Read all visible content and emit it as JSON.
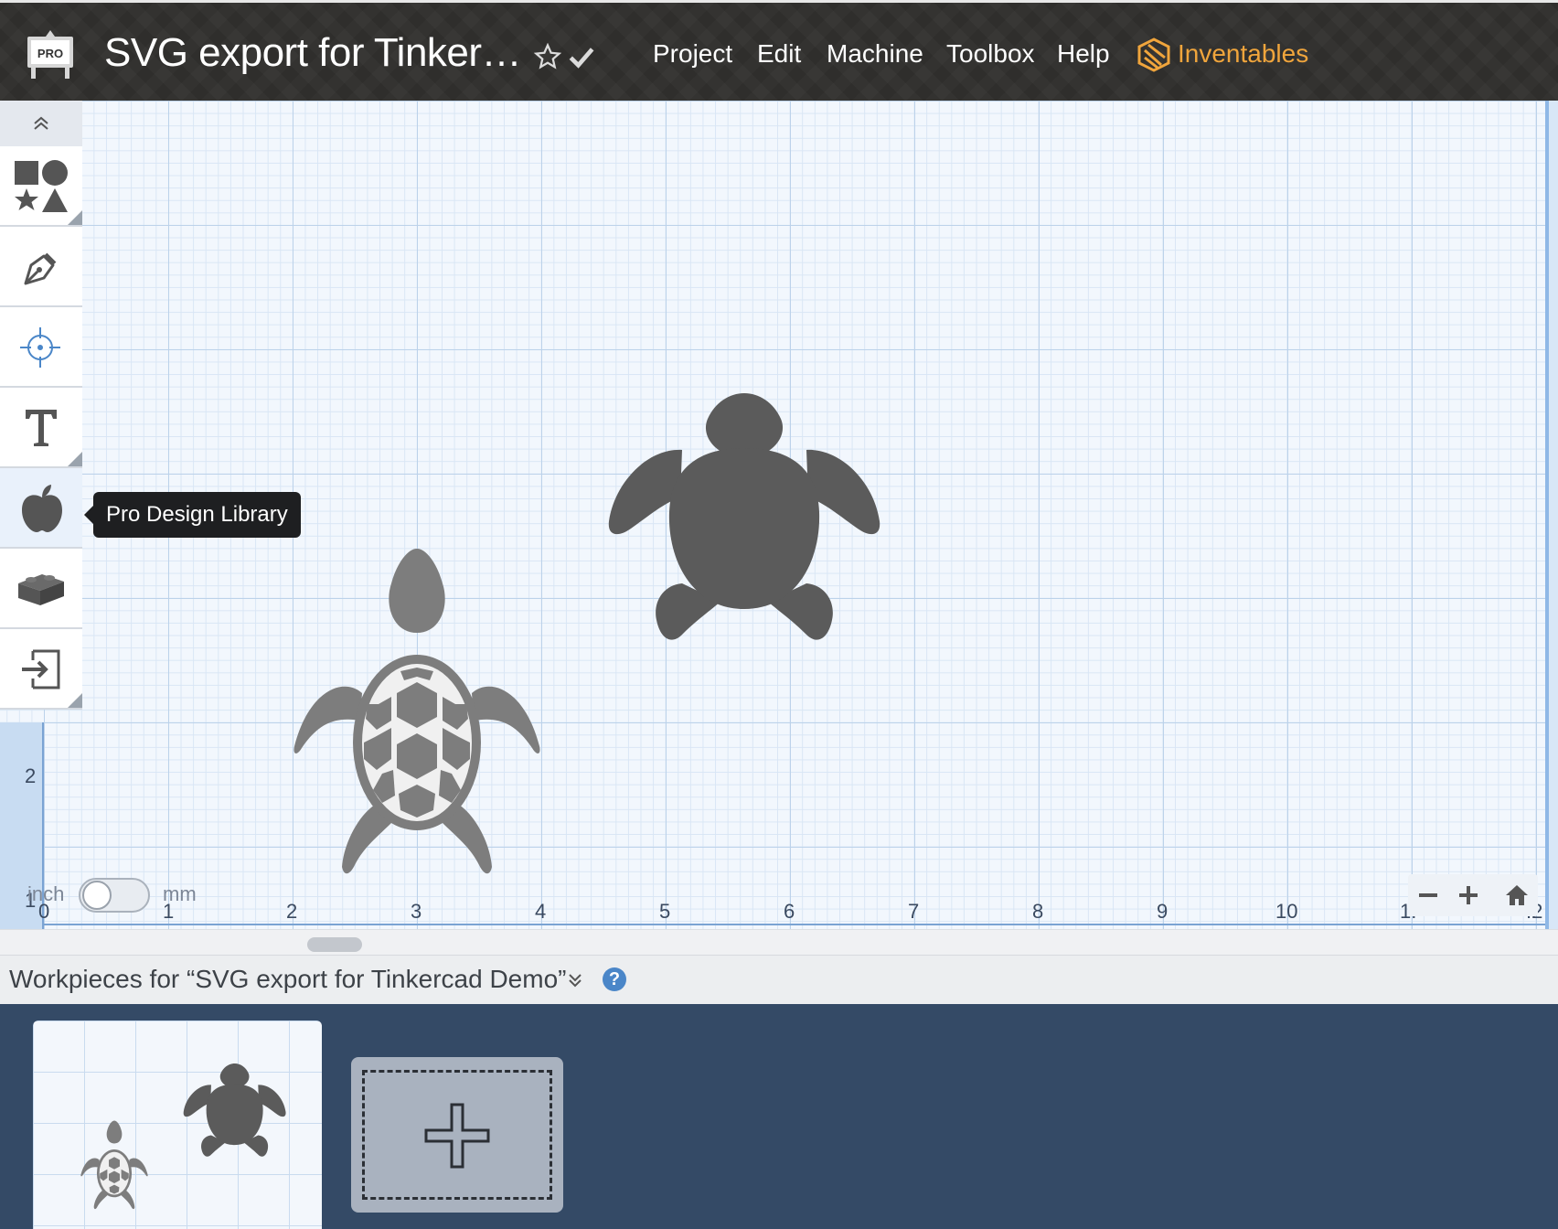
{
  "header": {
    "badge": "PRO",
    "project_title": "SVG export for Tinker…",
    "menu": [
      "Project",
      "Edit",
      "Machine",
      "Toolbox",
      "Help"
    ],
    "brand": "Inventables",
    "brand_color": "#f0a53c"
  },
  "toolbar": {
    "tools": [
      "shapes-icon",
      "pen-icon",
      "target-icon",
      "text-icon",
      "apple-icon",
      "brick-icon",
      "import-icon"
    ],
    "tooltip": "Pro Design Library"
  },
  "canvas": {
    "x_ruler": [
      "0",
      "1",
      "2",
      "3",
      "4",
      "5",
      "6",
      "7",
      "8",
      "9",
      "10",
      "1.",
      ".2"
    ],
    "y_ruler": [
      "2",
      "1"
    ],
    "unit_left": "inch",
    "unit_right": "mm",
    "unit_toggle_value": "inch"
  },
  "workpieces": {
    "title": "Workpieces for “SVG export for Tinkercad Demo”",
    "help": "?"
  },
  "colors": {
    "topbar": "#2f2e2c",
    "canvas_bg": "#f2f7fd",
    "grid_major": "#bcd2ea",
    "workpiece_area": "#344a66"
  }
}
